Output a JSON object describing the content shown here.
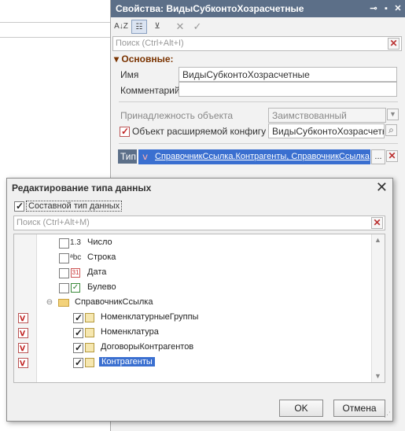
{
  "properties_panel": {
    "title": "Свойства: ВидыСубконтоХозрасчетные",
    "search_placeholder": "Поиск (Ctrl+Alt+I)",
    "section": "Основные:",
    "name_label": "Имя",
    "name_value": "ВидыСубконтоХозрасчетные",
    "comment_label": "Комментарий",
    "comment_value": "",
    "belonging_label": "Принадлежность объекта",
    "belonging_value": "Заимствованный",
    "extension_label": "Объект расширяемой конфигурац",
    "extension_value": "ВидыСубконтоХозрасчетные",
    "type_label": "Тип",
    "type_value": "СправочникСсылка.Контрагенты, СправочникСсылка",
    "type_dots": "..."
  },
  "dialog": {
    "title": "Редактирование типа данных",
    "composite_label": "Составной тип данных",
    "search_placeholder": "Поиск (Ctrl+Alt+M)",
    "tree": [
      {
        "label": "Число",
        "icon": "1.3",
        "checked": false,
        "selected": false
      },
      {
        "label": "Строка",
        "icon": "abc",
        "checked": false,
        "selected": false
      },
      {
        "label": "Дата",
        "icon": "31",
        "checked": false,
        "selected": false
      },
      {
        "label": "Булево",
        "icon": "✔",
        "checked": false,
        "selected": false
      },
      {
        "label": "СправочникСсылка",
        "icon": "folder",
        "checked": false,
        "selected": false
      },
      {
        "label": "НоменклатурныеГруппы",
        "icon": "catalog",
        "checked": true,
        "selected": false
      },
      {
        "label": "Номенклатура",
        "icon": "catalog",
        "checked": true,
        "selected": false
      },
      {
        "label": "ДоговорыКонтрагентов",
        "icon": "catalog",
        "checked": true,
        "selected": false
      },
      {
        "label": "Контрагенты",
        "icon": "catalog",
        "checked": true,
        "selected": true
      }
    ],
    "ok_label": "OK",
    "cancel_label": "Отмена"
  },
  "colors": {
    "title_bar": "#5c6f88",
    "selection": "#3a6fd0",
    "section_header": "#7a3300"
  }
}
